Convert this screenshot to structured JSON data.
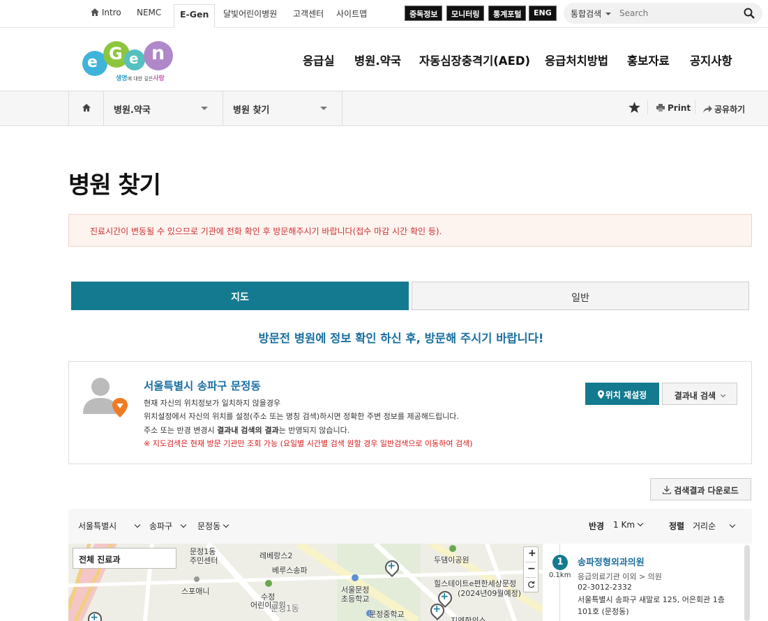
{
  "topbar": {
    "links": [
      {
        "label": "Intro",
        "icon": "home-icon"
      },
      {
        "label": "NEMC"
      },
      {
        "label": "E-Gen",
        "active": true
      },
      {
        "label": "달빛어린이병원"
      },
      {
        "label": "고객센터"
      },
      {
        "label": "사이트맵"
      }
    ],
    "black_buttons": [
      "중독정보",
      "모니터링",
      "통계포털",
      "ENG"
    ],
    "search_scope": "통합검색",
    "search_placeholder": "Search"
  },
  "logo": {
    "tagline_part1": "생명",
    "tagline_part2": "에 대한 깊은",
    "tagline_part3": "사랑"
  },
  "main_nav": [
    "응급실",
    "병원.약국",
    "자동심장충격기(AED)",
    "응급처치방법",
    "홍보자료",
    "공지사항"
  ],
  "breadcrumb": {
    "level1": "병원.약국",
    "level2": "병원 찾기",
    "print": "Print",
    "share": "공유하기"
  },
  "page": {
    "title": "병원 찾기",
    "notice": "진료시간이 변동될 수 있으므로 기관에 전화 확인 후 방문해주시기 바랍니다(접수 마감 시간 확인 등).",
    "tabs": [
      {
        "label": "지도",
        "active": true
      },
      {
        "label": "일반",
        "active": false
      }
    ],
    "subheading": "방문전 병원에 정보 확인 하신 후, 방문해 주시기 바랍니다!"
  },
  "location": {
    "address": "서울특별시 송파구 문정동",
    "line1": "현재 자신의 위치정보가 일치하지 않을경우",
    "line2": "위치설정에서 자신의 위치를 설정(주소 또는 명칭 검색)하시면 정확한 주변 정보를 제공해드립니다.",
    "line3_a": "주소 또는 반경 변경시 ",
    "line3_b": "결과내 검색의 결과",
    "line3_c": "는 반영되지 않습니다.",
    "warning": "※ 지도검색은 현재 방문 기관만 조회 가능 (요일별 시간별 검색 원할 경우 일반검색으로 이동하여 검색)",
    "reset_button": "위치 재설정",
    "filter_button": "결과내 검색"
  },
  "download_button": "검색결과 다운로드",
  "filters": {
    "city": "서울특별시",
    "district": "송파구",
    "dong": "문정동",
    "radius_label": "반경",
    "radius": "1 Km",
    "sort_label": "정렬",
    "sort": "거리순"
  },
  "map": {
    "dept_filter": "전체 진료과",
    "zoom_in": "+",
    "zoom_out": "−",
    "labels": {
      "l1": "문정1동",
      "l1b": "주민센터",
      "l2": "레베랑스2",
      "l3": "베루스송파",
      "l4": "스포애니",
      "l5": "수정",
      "l5b": "어린이공원",
      "l6": "문정1동",
      "l7": "서울문정",
      "l7b": "초등학교",
      "l8": "문정중학교",
      "l9": "두댐이공원",
      "l10": "힐스테이트e편한세상문정",
      "l10b": "(2024년09월예정)",
      "l11": "지엔한의스"
    }
  },
  "results": [
    {
      "rank": "1",
      "distance": "0.1km",
      "name": "송파정형외과의원",
      "type": "응급의료기관 이외 > 의원",
      "phone": "02-3012-2332",
      "address": "서울특별시 송파구 새말로 125, 어은회관 1층 101호 (문정동)"
    }
  ],
  "colors": {
    "teal": "#147a8f",
    "link_blue": "#1a6fa0",
    "notice_red": "#cc3333",
    "warning_red": "#d81b1b"
  }
}
